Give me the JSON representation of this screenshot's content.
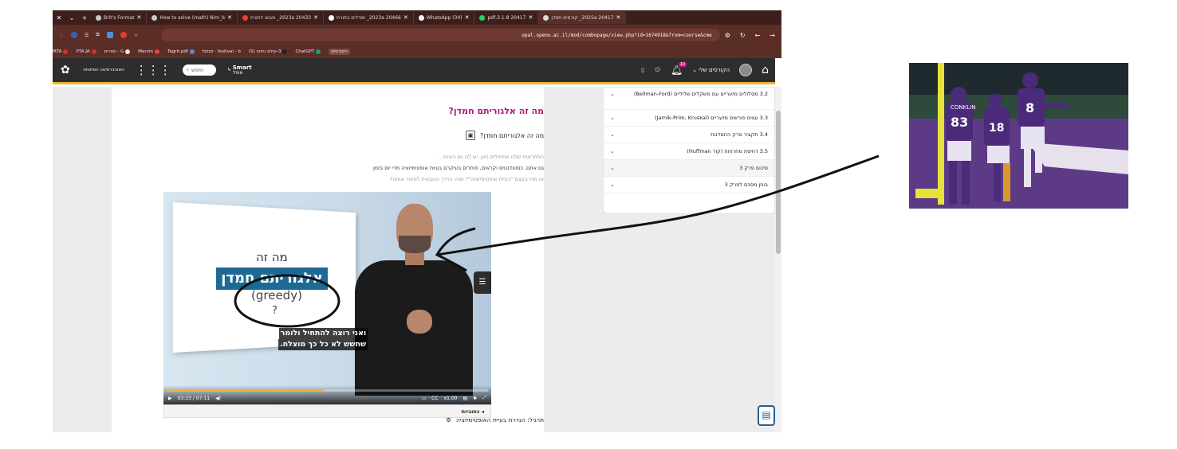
{
  "browser": {
    "tabs": [
      {
        "title": "Brit's Format",
        "active": false
      },
      {
        "title": "How to solve (math) Nim_b",
        "active": false
      },
      {
        "title": "20433 2023a_ מבוא לתורת",
        "active": false
      },
      {
        "title": "20466 2023a_ מודלים בתורת",
        "active": false
      },
      {
        "title": "(34) WhatsApp",
        "active": false
      },
      {
        "title": "20417 3.1.8.pdf",
        "active": false
      },
      {
        "title": "20417 2025a_ קורסים חמדן",
        "active": true
      }
    ],
    "url": "opal.openu.ac.il/mod/combopage/view.php?id=1674918&from=course&cme",
    "bookmarks": [
      "הקורסים",
      "ChatGPT",
      "3-עולם ניתוח (S)",
      "fzzzz - festival - b",
      "Tagrit.pdf",
      "Marvin",
      "G - ספרים",
      "PTA JA",
      "MTA"
    ]
  },
  "header": {
    "logo_text": "האוניברסיטה הפתוחה",
    "search_label": "חיפוש",
    "smart_label": "Smart",
    "smart_sub": "אופל",
    "my_courses": "הקורסים שלי",
    "notification_count": "10"
  },
  "content": {
    "title": "מה זה אלגוריתם חמדן?",
    "subheading": "מה זה אלגוריתם חמדן?",
    "lines": [
      "הפתרונות שלנו מתחילים כאן. יש לנו גם בעיות...",
      "גם אתם. כסטודנטים וקראים, פותרים בעיקרם בעיות אופטימיזציה מדי יום בזמן",
      "או מהי בעצם \"בעיית אופטימיזציה\"? ומהי הדרך הטבעית לפתור אותה?"
    ],
    "video": {
      "slide_title": "מה זה",
      "slide_banner": "אלגוריתם חמדן",
      "slide_sub": "(greedy)",
      "slide_q": "?",
      "subtitle_line1": "ואני רוצה להתחיל ולומר",
      "subtitle_line2": "שחשש לא כל כך מוצלח.",
      "time_current": "03:33",
      "time_total": "07:11",
      "speed": "x1.00",
      "progress": 0.49,
      "captions_label": "כתוביות"
    },
    "exercise": "תרגיל: הגדרת בעיית האופטימיזציה"
  },
  "nav": {
    "items": [
      {
        "label": "3.2 מסלולים מזעריים עם משקלים שליליים (Bellman-Ford)",
        "tall": true,
        "alt": false
      },
      {
        "label": "3.3 עצים פורשים מזעריים (Jarnik-Prim, Kruskal)",
        "tall": false,
        "alt": false
      },
      {
        "label": "3.4 תקציר פרק החמדנות",
        "tall": false,
        "alt": false
      },
      {
        "label": "3.5 דחיסת מחרוזות (קוד Huffman)",
        "tall": false,
        "alt": false
      },
      {
        "label": "סיכום פרק 3",
        "tall": false,
        "alt": true
      },
      {
        "label": "בוחן מסכם לפרק 3",
        "tall": false,
        "alt": false
      }
    ]
  },
  "photo": {
    "jersey_name": "CONKLIN",
    "jersey_number_left": "83",
    "jersey_number_mid": "18",
    "jersey_number_right": "8"
  },
  "colors": {
    "chrome": "#5b2d27",
    "site_header": "#2d2d2d",
    "accent": "#f2b233",
    "heading": "#b01a7a",
    "turf": "#5d3a86"
  }
}
